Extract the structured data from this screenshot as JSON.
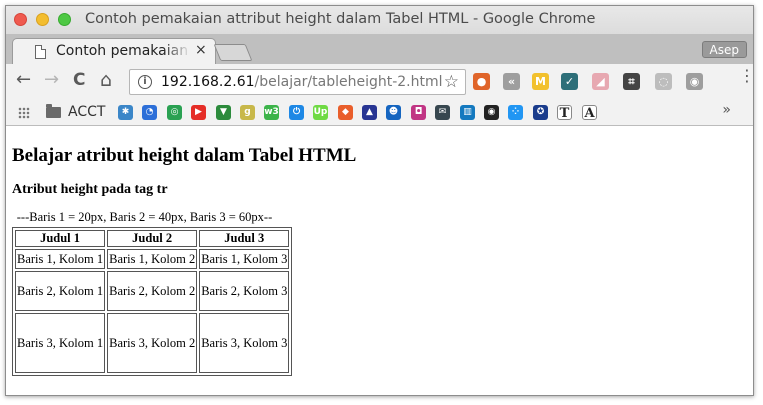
{
  "window": {
    "title": "Contoh pemakaian attribut height dalam Tabel HTML - Google Chrome"
  },
  "tab": {
    "title": "Contoh pemakaian attribut height dalam Tabel HTML",
    "close_label": "×"
  },
  "profile": {
    "name": "Asep"
  },
  "toolbar": {
    "back": "←",
    "forward": "→",
    "reload": "C",
    "home": "⌂",
    "url_host": "192.168.2.61",
    "url_path": "/belajar/tableheight-2.html",
    "star": "☆",
    "info": "i",
    "menu": "⋮"
  },
  "extensions": [
    {
      "icon": "ublock-icon",
      "glyph": "●",
      "color": "#e0652a"
    },
    {
      "icon": "back-circle-icon",
      "glyph": "«",
      "color": "#9e9e9e"
    },
    {
      "icon": "m-extension-icon",
      "glyph": "M",
      "color": "#f2c12e"
    },
    {
      "icon": "checkmark-extension-icon",
      "glyph": "✓",
      "color": "#2e6f79"
    },
    {
      "icon": "eraser-icon",
      "glyph": "◢",
      "color": "#e7a8b1"
    },
    {
      "icon": "crop-icon",
      "glyph": "⌗",
      "color": "#444444"
    },
    {
      "icon": "sync-icon",
      "glyph": "◌",
      "color": "#bdbdbd"
    },
    {
      "icon": "camera-icon",
      "glyph": "◉",
      "color": "#9e9e9e"
    }
  ],
  "bookmarks": {
    "folder_label": "ACCT",
    "more": "»",
    "items": [
      {
        "icon": "snowflake-icon",
        "glyph": "✱",
        "color": "#3b86c8"
      },
      {
        "icon": "spinner-icon",
        "glyph": "◔",
        "color": "#2d6fd8"
      },
      {
        "icon": "chrome-icon",
        "glyph": "◎",
        "color": "#2aa152"
      },
      {
        "icon": "youtube-icon",
        "glyph": "▶",
        "color": "#e52d27"
      },
      {
        "icon": "vfilter-icon",
        "glyph": "▼",
        "color": "#2c8b3c"
      },
      {
        "icon": "g-icon",
        "glyph": "g",
        "color": "#c8b84a"
      },
      {
        "icon": "w3-icon",
        "glyph": "w3",
        "color": "#3cb44a"
      },
      {
        "icon": "power-icon",
        "glyph": "⏻",
        "color": "#1e88e5"
      },
      {
        "icon": "upwork-icon",
        "glyph": "Up",
        "color": "#6fda44"
      },
      {
        "icon": "cube-icon",
        "glyph": "◆",
        "color": "#e95e2b"
      },
      {
        "icon": "triangle-icon",
        "glyph": "▲",
        "color": "#283593"
      },
      {
        "icon": "face-icon",
        "glyph": "☻",
        "color": "#1565c0"
      },
      {
        "icon": "instagram-icon",
        "glyph": "◘",
        "color": "#c13584"
      },
      {
        "icon": "envelope-icon",
        "glyph": "✉",
        "color": "#37474f"
      },
      {
        "icon": "trello-icon",
        "glyph": "▥",
        "color": "#1479bf"
      },
      {
        "icon": "record-icon",
        "glyph": "◉",
        "color": "#222222"
      },
      {
        "icon": "dots-icon",
        "glyph": "⁘",
        "color": "#2196f3"
      },
      {
        "icon": "emblem-icon",
        "glyph": "✪",
        "color": "#1a3c8c"
      },
      {
        "icon": "t-icon",
        "glyph": "T",
        "color": "#222222"
      },
      {
        "icon": "a-icon",
        "glyph": "A",
        "color": "#222222"
      }
    ]
  },
  "page": {
    "heading": "Belajar atribut height dalam Tabel HTML",
    "subheading": "Atribut height pada tag tr",
    "caption": "---Baris 1 = 20px, Baris 2 = 40px, Baris 3 = 60px--",
    "table": {
      "headers": [
        "Judul 1",
        "Judul 2",
        "Judul 3"
      ],
      "rows": [
        {
          "height": 20,
          "cells": [
            "Baris 1, Kolom 1",
            "Baris 1, Kolom 2",
            "Baris 1, Kolom 3"
          ]
        },
        {
          "height": 40,
          "cells": [
            "Baris 2, Kolom 1",
            "Baris 2, Kolom 2",
            "Baris 2, Kolom 3"
          ]
        },
        {
          "height": 60,
          "cells": [
            "Baris 3, Kolom 1",
            "Baris 3, Kolom 2",
            "Baris 3, Kolom 3"
          ]
        }
      ]
    }
  }
}
